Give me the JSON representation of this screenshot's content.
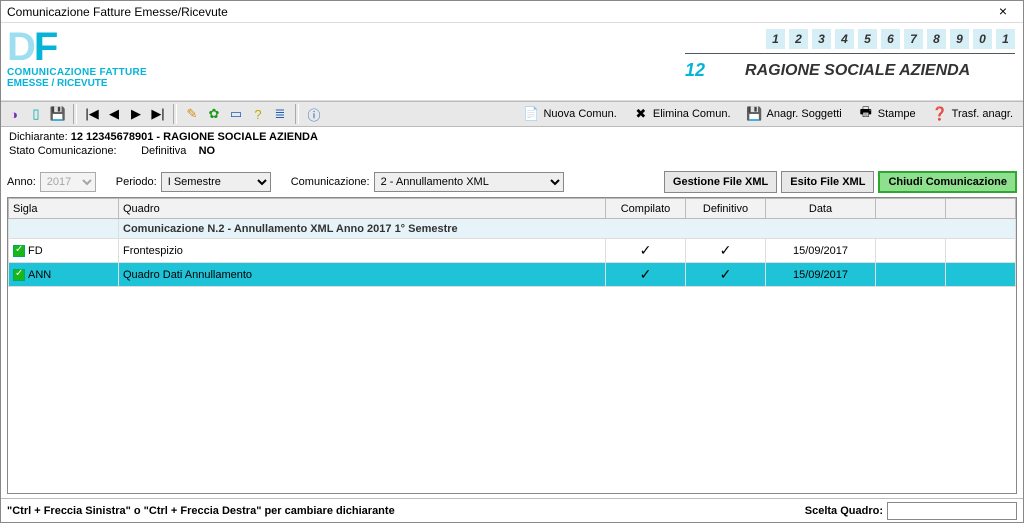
{
  "window": {
    "title": "Comunicazione Fatture Emesse/Ricevute"
  },
  "logo": {
    "sub1": "COMUNICAZIONE FATTURE",
    "sub2": "EMESSE / RICEVUTE"
  },
  "header": {
    "digits": [
      "1",
      "2",
      "3",
      "4",
      "5",
      "6",
      "7",
      "8",
      "9",
      "0",
      "1"
    ],
    "num": "12",
    "ragione": "RAGIONE SOCIALE AZIENDA"
  },
  "toolbar": {
    "nuova": "Nuova Comun.",
    "elimina": "Elimina Comun.",
    "anagr": "Anagr. Soggetti",
    "stampe": "Stampe",
    "trasf": "Trasf. anagr."
  },
  "dich": {
    "label": "Dichiarante:",
    "value": "12 12345678901 - RAGIONE SOCIALE AZIENDA",
    "stato_label": "Stato Comunicazione:",
    "def_label": "Definitiva",
    "def_value": "NO"
  },
  "filters": {
    "anno_label": "Anno:",
    "anno_value": "2017",
    "periodo_label": "Periodo:",
    "periodo_value": "I Semestre",
    "comun_label": "Comunicazione:",
    "comun_value": "2 - Annullamento XML",
    "btn_gestione": "Gestione File XML",
    "btn_esito": "Esito File XML",
    "btn_chiudi": "Chiudi Comunicazione"
  },
  "grid": {
    "headers": {
      "sigla": "Sigla",
      "quadro": "Quadro",
      "compilato": "Compilato",
      "definitivo": "Definitivo",
      "data": "Data"
    },
    "section": "Comunicazione N.2 - Annullamento XML  Anno 2017 1° Semestre",
    "rows": [
      {
        "sigla": "FD",
        "quadro": "Frontespizio",
        "compilato": "✓",
        "definitivo": "✓",
        "data": "15/09/2017",
        "selected": false
      },
      {
        "sigla": "ANN",
        "quadro": "Quadro Dati Annullamento",
        "compilato": "✓",
        "definitivo": "✓",
        "data": "15/09/2017",
        "selected": true
      }
    ]
  },
  "status": {
    "hint": "\"Ctrl + Freccia Sinistra\" o \"Ctrl + Freccia Destra\" per cambiare dichiarante",
    "scelta_label": "Scelta Quadro:",
    "scelta_value": ""
  }
}
